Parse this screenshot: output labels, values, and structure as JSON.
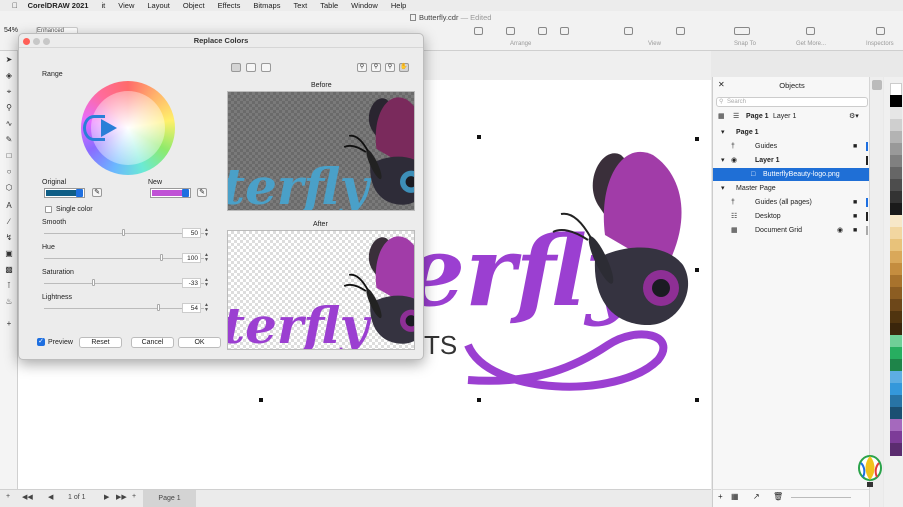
{
  "menubar": {
    "app_name": "CorelDRAW 2021",
    "items": [
      "Edit",
      "View",
      "Layout",
      "Object",
      "Effects",
      "Bitmaps",
      "Text",
      "Table",
      "Window",
      "Help"
    ],
    "edit_visible": "it"
  },
  "toolbar": {
    "zoom": "54%",
    "mode": "Enhanced",
    "doc_title": "Butterfly.cdr",
    "doc_state": "— Edited",
    "labels": {
      "arrange": "Arrange",
      "view": "View",
      "snap": "Snap To",
      "getmore": "Get More...",
      "inspectors": "Inspectors"
    }
  },
  "dialog": {
    "title": "Replace Colors",
    "range_label": "Range",
    "original_label": "Original",
    "new_label": "New",
    "original_color": "#0f5e86",
    "new_color": "#c052d6",
    "single_color_label": "Single color",
    "sliders": [
      {
        "label": "Smooth",
        "value": "50",
        "fraction": 0.5
      },
      {
        "label": "Hue",
        "value": "100",
        "fraction": 0.74
      },
      {
        "label": "Saturation",
        "value": "-33",
        "fraction": 0.31
      },
      {
        "label": "Lightness",
        "value": "54",
        "fraction": 0.72
      }
    ],
    "before_label": "Before",
    "after_label": "After",
    "preview_label": "Preview",
    "preview_checked": true,
    "reset_label": "Reset",
    "cancel_label": "Cancel",
    "ok_label": "OK"
  },
  "artwork": {
    "text_canvas": "erfly",
    "text_before": "terfly",
    "text_after": "terfly",
    "sub_text": "TS",
    "purple": "#9b3fd1",
    "before_teal": "#4aa0c8"
  },
  "objects_panel": {
    "title": "Objects",
    "search_placeholder": "Search",
    "page_label": "Page 1",
    "layer_label": "Layer 1",
    "tree": [
      {
        "label": "Page 1",
        "bold": true
      },
      {
        "label": "Guides",
        "bold": false
      },
      {
        "label": "Layer 1",
        "bold": true
      },
      {
        "label": "ButterflyBeauty-logo.png",
        "selected": true
      },
      {
        "label": "Master Page",
        "bold": false
      },
      {
        "label": "Guides (all pages)",
        "bold": false
      },
      {
        "label": "Desktop",
        "bold": false
      },
      {
        "label": "Document Grid",
        "bold": false
      }
    ]
  },
  "statusbar": {
    "page_count": "1 of 1",
    "page_tab": "Page 1"
  },
  "colors": {
    "accent": "#1e6fe0",
    "selection": "#1f6fd6"
  }
}
